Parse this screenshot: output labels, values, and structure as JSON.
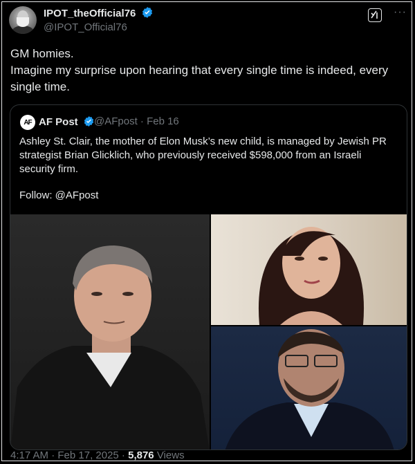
{
  "header": {
    "display_name": "IPOT_theOfficial76",
    "handle": "@IPOT_Official76",
    "more": "···"
  },
  "tweet": {
    "line1": "GM homies.",
    "line2": "Imagine my surprise upon hearing that every single time is indeed, every single time."
  },
  "quote": {
    "avatar_text": "AF",
    "name": "AF Post",
    "meta": "@AFpost · Feb 16",
    "body": "Ashley St. Clair, the mother of Elon Musk’s new child, is managed by Jewish PR strategist Brian Glicklich, who previously received $598,000 from an Israeli security firm.",
    "follow": "Follow: @AFpost"
  },
  "footer": {
    "time": "4:17 AM · Feb 17, 2025 ·",
    "views_count": "5,876",
    "views_label": "Views"
  },
  "colors": {
    "background": "#000000",
    "text": "#e7e9ea",
    "muted": "#71767b",
    "verified": "#1d9bf0",
    "quote_border": "#2f3336"
  },
  "icons": {
    "verified": "verified-badge-icon",
    "grok": "grok-icon",
    "more": "more-icon"
  }
}
